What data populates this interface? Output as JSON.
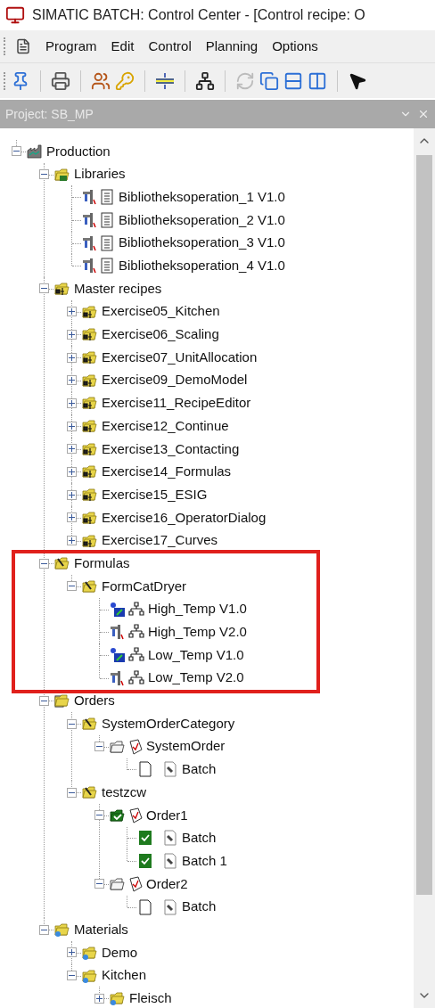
{
  "window": {
    "title": "SIMATIC BATCH: Control Center - [Control recipe: O"
  },
  "menu": [
    "Program",
    "Edit",
    "Control",
    "Planning",
    "Options"
  ],
  "toolbar": [
    {
      "kind": "pin",
      "disabled": false
    },
    {
      "kind": "sep"
    },
    {
      "kind": "printer",
      "disabled": false
    },
    {
      "kind": "sep"
    },
    {
      "kind": "users",
      "disabled": false
    },
    {
      "kind": "key",
      "disabled": false
    },
    {
      "kind": "sep"
    },
    {
      "kind": "split",
      "disabled": false
    },
    {
      "kind": "sep"
    },
    {
      "kind": "network",
      "disabled": false
    },
    {
      "kind": "sep"
    },
    {
      "kind": "refresh",
      "disabled": true
    },
    {
      "kind": "cascade",
      "disabled": false
    },
    {
      "kind": "rows",
      "disabled": false
    },
    {
      "kind": "columns",
      "disabled": false
    },
    {
      "kind": "sep"
    },
    {
      "kind": "help",
      "disabled": false
    }
  ],
  "panel": {
    "title": "Project: SB_MP"
  },
  "tree": [
    {
      "label": "Production",
      "kind": "plant",
      "expanded": true,
      "children": [
        {
          "label": "Libraries",
          "kind": "library_folder",
          "expanded": true,
          "children": [
            {
              "label": "Bibliotheksoperation_1 V1.0",
              "kind": "library_operation"
            },
            {
              "label": "Bibliotheksoperation_2 V1.0",
              "kind": "library_operation"
            },
            {
              "label": "Bibliotheksoperation_3 V1.0",
              "kind": "library_operation"
            },
            {
              "label": "Bibliotheksoperation_4 V1.0",
              "kind": "library_operation"
            }
          ]
        },
        {
          "label": "Master recipes",
          "kind": "recipe_folder",
          "expanded": true,
          "children": [
            {
              "label": "Exercise05_Kitchen",
              "kind": "recipe",
              "expanded": false
            },
            {
              "label": "Exercise06_Scaling",
              "kind": "recipe",
              "expanded": false
            },
            {
              "label": "Exercise07_UnitAllocation",
              "kind": "recipe",
              "expanded": false
            },
            {
              "label": "Exercise09_DemoModel",
              "kind": "recipe",
              "expanded": false
            },
            {
              "label": "Exercise11_RecipeEditor",
              "kind": "recipe",
              "expanded": false
            },
            {
              "label": "Exercise12_Continue",
              "kind": "recipe",
              "expanded": false
            },
            {
              "label": "Exercise13_Contacting",
              "kind": "recipe",
              "expanded": false
            },
            {
              "label": "Exercise14_Formulas",
              "kind": "recipe",
              "expanded": false
            },
            {
              "label": "Exercise15_ESIG",
              "kind": "recipe",
              "expanded": false
            },
            {
              "label": "Exercise16_OperatorDialog",
              "kind": "recipe",
              "expanded": false
            },
            {
              "label": "Exercise17_Curves",
              "kind": "recipe",
              "expanded": false
            }
          ]
        },
        {
          "label": "Formulas",
          "kind": "formula_folder",
          "expanded": true,
          "highlighted": true,
          "children": [
            {
              "label": "FormCatDryer",
              "kind": "formula_folder",
              "expanded": true,
              "children": [
                {
                  "label": "High_Temp V1.0",
                  "kind": "formula",
                  "released": true
                },
                {
                  "label": "High_Temp V2.0",
                  "kind": "formula",
                  "released": false
                },
                {
                  "label": "Low_Temp V1.0",
                  "kind": "formula",
                  "released": true
                },
                {
                  "label": "Low_Temp V2.0",
                  "kind": "formula",
                  "released": false
                }
              ]
            }
          ]
        },
        {
          "label": "Orders",
          "kind": "orders_root",
          "expanded": true,
          "children": [
            {
              "label": "SystemOrderCategory",
              "kind": "formula_folder",
              "expanded": true,
              "children": [
                {
                  "label": "SystemOrder",
                  "kind": "order",
                  "completed": false,
                  "expanded": true,
                  "children": [
                    {
                      "label": "Batch",
                      "kind": "batch",
                      "completed": false
                    }
                  ]
                }
              ]
            },
            {
              "label": "testzcw",
              "kind": "formula_folder",
              "expanded": true,
              "children": [
                {
                  "label": "Order1",
                  "kind": "order",
                  "completed": true,
                  "expanded": true,
                  "children": [
                    {
                      "label": "Batch",
                      "kind": "batch",
                      "completed": true
                    },
                    {
                      "label": "Batch 1",
                      "kind": "batch",
                      "completed": true
                    }
                  ]
                },
                {
                  "label": "Order2",
                  "kind": "order",
                  "completed": false,
                  "expanded": true,
                  "children": [
                    {
                      "label": "Batch",
                      "kind": "batch",
                      "completed": false
                    }
                  ]
                }
              ]
            }
          ]
        },
        {
          "label": "Materials",
          "kind": "material_folder",
          "expanded": true,
          "children": [
            {
              "label": "Demo",
              "kind": "material_folder",
              "expanded": false
            },
            {
              "label": "Kitchen",
              "kind": "material_folder",
              "expanded": true,
              "children": [
                {
                  "label": "Fleisch",
                  "kind": "material_folder",
                  "expanded": false
                }
              ]
            }
          ]
        }
      ]
    }
  ]
}
